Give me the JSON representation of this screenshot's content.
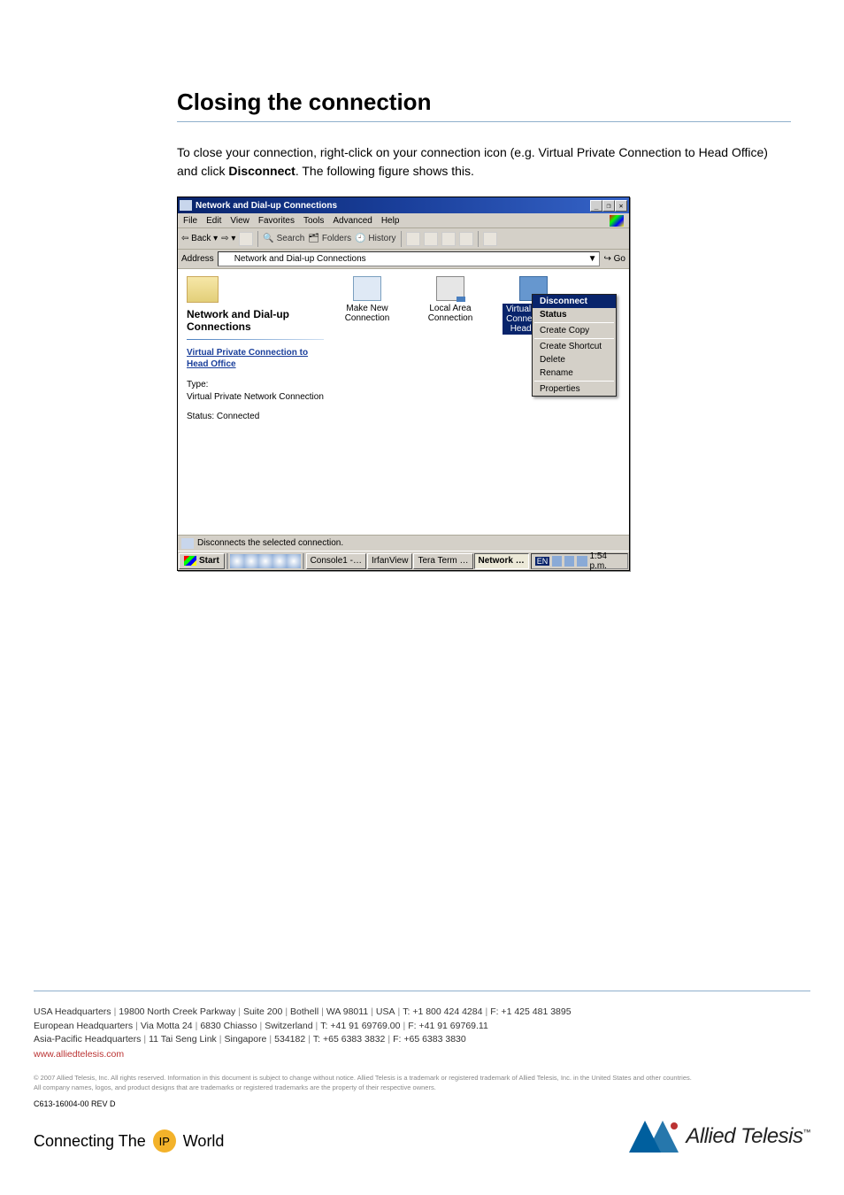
{
  "heading": "Closing the connection",
  "body_pre": "To close your connection, right-click on your connection icon (e.g. Virtual Private Connection to Head Office) and click ",
  "body_bold": "Disconnect",
  "body_post": ". The following figure shows this.",
  "window": {
    "title": "Network and Dial-up Connections",
    "winbtns": [
      "_",
      "❐",
      "✕"
    ],
    "menus": [
      "File",
      "Edit",
      "View",
      "Favorites",
      "Tools",
      "Advanced",
      "Help"
    ],
    "toolbar": {
      "back": "Back",
      "search": "Search",
      "folders": "Folders",
      "history": "History"
    },
    "addressbar": {
      "label": "Address",
      "value": "Network and Dial-up Connections",
      "go": "Go"
    },
    "side": {
      "header": "Network and Dial-up Connections",
      "link": "Virtual Private Connection to Head Office",
      "type_label": "Type:",
      "type_value": "Virtual Private Network Connection",
      "status_label": "Status:",
      "status_value": "Connected"
    },
    "icons": [
      {
        "name": "Make New Connection",
        "kind": "mnc"
      },
      {
        "name": "Local Area Connection",
        "kind": "lac"
      },
      {
        "name": "Virtual Private Connection to Head Office",
        "kind": "vpc",
        "selected": true
      }
    ],
    "contextmenu": {
      "items": [
        "Disconnect",
        "Status",
        "Create Copy",
        "Create Shortcut",
        "Delete",
        "Rename",
        "Properties"
      ],
      "highlighted": 0
    },
    "statusbar": "Disconnects the selected connection.",
    "taskbar": {
      "start": "Start",
      "tasks": [
        "Console1 -…",
        "IrfanView",
        "Tera Term …",
        "Network …"
      ],
      "active": 3,
      "tray_lang": "EN",
      "clock": "1:54 p.m."
    }
  },
  "footer": {
    "usa": {
      "label": "USA Headquarters",
      "parts": [
        "19800 North Creek Parkway",
        "Suite 200",
        "Bothell",
        "WA 98011",
        "USA",
        "T: +1 800 424 4284",
        "F: +1 425 481 3895"
      ]
    },
    "eur": {
      "label": "European Headquarters",
      "parts": [
        "Via Motta 24",
        "6830 Chiasso",
        "Switzerland",
        "T: +41 91 69769.00",
        "F: +41 91 69769.11"
      ]
    },
    "apac": {
      "label": "Asia-Pacific Headquarters",
      "parts": [
        "11 Tai Seng Link",
        "Singapore",
        "534182",
        "T: +65 6383 3832",
        "F: +65 6383 3830"
      ]
    },
    "url": "www.alliedtelesis.com",
    "legal1": "© 2007 Allied Telesis, Inc. All rights reserved. Information in this document is subject to change without notice.  Allied Telesis is a trademark or registered trademark of Allied Telesis, Inc. in the United States and other countries.",
    "legal2": "All company names, logos, and product designs that are trademarks or registered trademarks are the property of their respective owners.",
    "docid": "C613-16004-00 REV D",
    "tagline_pre": "Connecting The",
    "tagline_ip": "IP",
    "tagline_post": "World",
    "brand": "Allied Telesis"
  }
}
